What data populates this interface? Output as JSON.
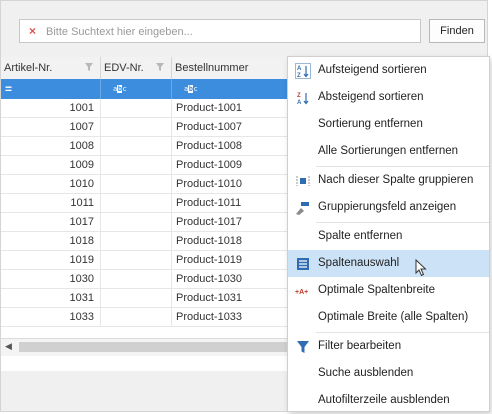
{
  "search": {
    "placeholder": "Bitte Suchtext hier eingeben...",
    "clear_icon": "x-icon",
    "find_label": "Finden"
  },
  "grid": {
    "columns": [
      {
        "label": "Artikel-Nr."
      },
      {
        "label": "EDV-Nr."
      },
      {
        "label": "Bestellnummer"
      }
    ],
    "autofilter": {
      "col1": "=",
      "col2_icon": "abc-icon",
      "col3_icon": "abc-icon"
    },
    "rows": [
      {
        "artikel": "1001",
        "edv": "",
        "bestell": "Product-1001"
      },
      {
        "artikel": "1007",
        "edv": "",
        "bestell": "Product-1007"
      },
      {
        "artikel": "1008",
        "edv": "",
        "bestell": "Product-1008"
      },
      {
        "artikel": "1009",
        "edv": "",
        "bestell": "Product-1009"
      },
      {
        "artikel": "1010",
        "edv": "",
        "bestell": "Product-1010"
      },
      {
        "artikel": "1011",
        "edv": "",
        "bestell": "Product-1011"
      },
      {
        "artikel": "1017",
        "edv": "",
        "bestell": "Product-1017"
      },
      {
        "artikel": "1018",
        "edv": "",
        "bestell": "Product-1018"
      },
      {
        "artikel": "1019",
        "edv": "",
        "bestell": "Product-1019"
      },
      {
        "artikel": "1030",
        "edv": "",
        "bestell": "Product-1030"
      },
      {
        "artikel": "1031",
        "edv": "",
        "bestell": "Product-1031"
      },
      {
        "artikel": "1033",
        "edv": "",
        "bestell": "Product-1033"
      }
    ]
  },
  "menu": {
    "items": [
      {
        "label": "Aufsteigend sortieren",
        "icon": "sort-ascending-icon"
      },
      {
        "label": "Absteigend sortieren",
        "icon": "sort-descending-icon"
      },
      {
        "label": "Sortierung entfernen",
        "icon": ""
      },
      {
        "label": "Alle Sortierungen entfernen",
        "icon": ""
      },
      {
        "label": "Nach dieser Spalte gruppieren",
        "icon": "group-by-column-icon"
      },
      {
        "label": "Gruppierungsfeld anzeigen",
        "icon": "group-panel-icon"
      },
      {
        "label": "Spalte entfernen",
        "icon": ""
      },
      {
        "label": "Spaltenauswahl",
        "icon": "column-chooser-icon"
      },
      {
        "label": "Optimale Spaltenbreite",
        "icon": "best-fit-icon"
      },
      {
        "label": "Optimale Breite (alle Spalten)",
        "icon": ""
      },
      {
        "label": "Filter bearbeiten",
        "icon": "filter-icon"
      },
      {
        "label": "Suche ausblenden",
        "icon": ""
      },
      {
        "label": "Autofilterzeile ausblenden",
        "icon": ""
      }
    ],
    "highlighted_item": "Spaltenauswahl"
  },
  "colors": {
    "selection_blue": "#3c8dde",
    "menu_highlight": "#cce3f7",
    "clear_red": "#d9534f"
  }
}
